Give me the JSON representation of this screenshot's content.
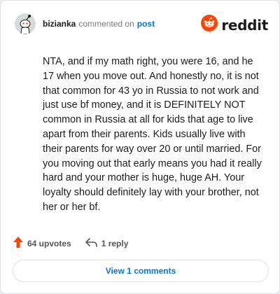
{
  "header": {
    "username": "bizianka",
    "action_text": "commented on",
    "post_link": "post",
    "brand": "reddit"
  },
  "comment": {
    "body": "NTA, and if my math right, you were 16, and he 17 when you move out. And honestly no, it is not that common for 43 yo in Russia to not work and just use bf money, and it is DEFINITELY NOT common in Russia at all for kids that age to live apart from their parents. Kids usually live with their parents for way over 20 or until married. For you moving out that early means you had it really hard and your mother is huge, huge AH. Your loyalty should definitely lay with your brother, not her or her bf."
  },
  "actions": {
    "upvotes": "64 upvotes",
    "replies": "1 reply"
  },
  "footer": {
    "view_comments": "View 1 comments"
  },
  "colors": {
    "brand_orange": "#ff4500",
    "link_blue": "#0079d3"
  },
  "icons": {
    "avatar": "snoo-avatar-icon",
    "brand": "reddit-logo-icon",
    "upvote": "upvote-arrow-icon",
    "reply": "reply-arrow-icon"
  }
}
